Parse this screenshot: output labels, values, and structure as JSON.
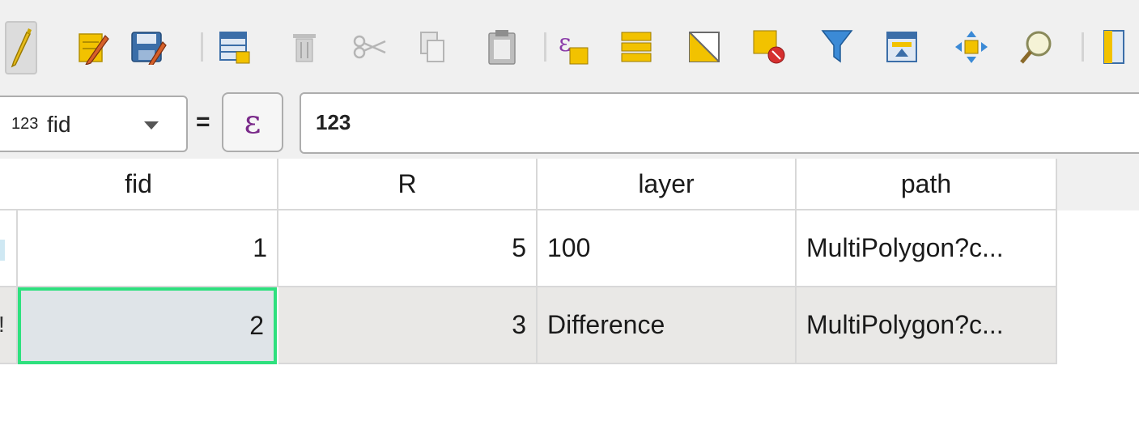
{
  "toolbar": {
    "buttons": [
      {
        "icon": "pencil-icon",
        "active": true
      },
      {
        "icon": "multi-edit-pencil-icon"
      },
      {
        "icon": "save-edits-icon"
      },
      {
        "icon": "add-feature-icon"
      },
      {
        "icon": "delete-selected-icon"
      },
      {
        "icon": "cut-icon"
      },
      {
        "icon": "copy-icon"
      },
      {
        "icon": "paste-icon"
      },
      {
        "icon": "select-by-expression-icon"
      },
      {
        "icon": "select-all-icon"
      },
      {
        "icon": "invert-selection-icon"
      },
      {
        "icon": "deselect-all-icon"
      },
      {
        "icon": "filter-icon"
      },
      {
        "icon": "move-selection-to-top-icon"
      },
      {
        "icon": "pan-to-selected-icon"
      },
      {
        "icon": "zoom-to-selected-icon"
      },
      {
        "icon": "new-field-icon"
      }
    ],
    "colors": {
      "pencil": "#e6b800",
      "folder": "#f2c200",
      "blue": "#3b6ea8",
      "red": "#d62f2f"
    }
  },
  "expression_bar": {
    "field_type": "123",
    "field_name": "fid",
    "operator": "=",
    "epsilon": "ε",
    "value": "123"
  },
  "table": {
    "columns": [
      "fid",
      "R",
      "layer",
      "path"
    ],
    "rows": [
      {
        "fid": "1",
        "R": "5",
        "layer": "100",
        "path": "MultiPolygon?c..."
      },
      {
        "fid": "2",
        "R": "3",
        "layer": "Difference",
        "path": "MultiPolygon?c..."
      }
    ],
    "selected_cell": {
      "row": 1,
      "column": "fid"
    },
    "selection_color": "#2ee07e"
  }
}
